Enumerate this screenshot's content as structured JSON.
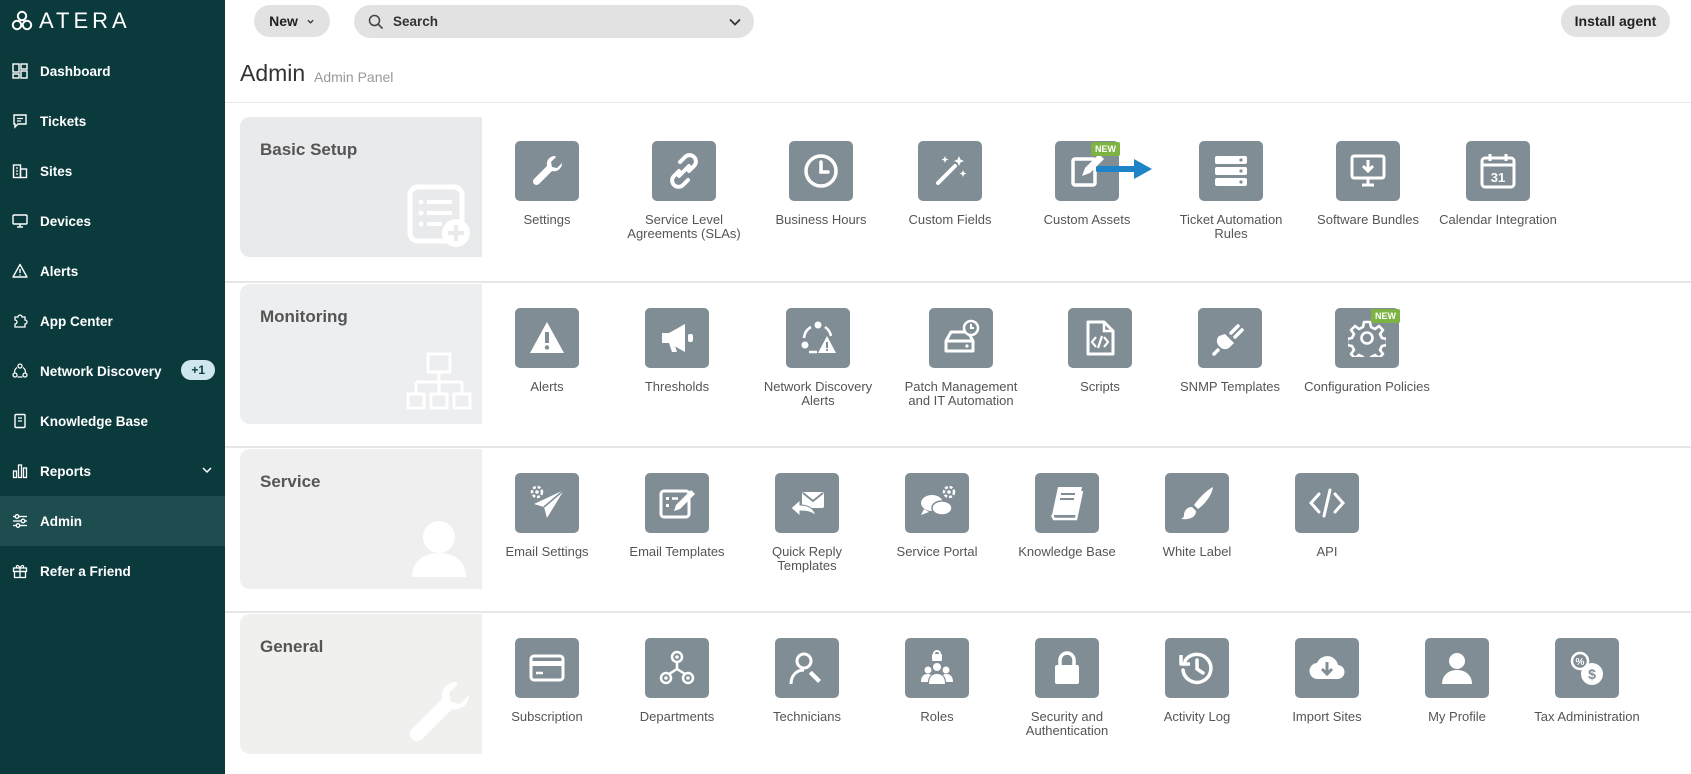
{
  "brand": {
    "name": "ATERA"
  },
  "sidebar": {
    "items": [
      {
        "label": "Dashboard",
        "icon": "dashboard-icon"
      },
      {
        "label": "Tickets",
        "icon": "tickets-icon"
      },
      {
        "label": "Sites",
        "icon": "sites-icon"
      },
      {
        "label": "Devices",
        "icon": "devices-icon"
      },
      {
        "label": "Alerts",
        "icon": "alerts-icon"
      },
      {
        "label": "App Center",
        "icon": "app-center-icon"
      },
      {
        "label": "Network Discovery",
        "icon": "network-discovery-icon",
        "badge": "+1"
      },
      {
        "label": "Knowledge Base",
        "icon": "knowledge-base-icon"
      },
      {
        "label": "Reports",
        "icon": "reports-icon"
      },
      {
        "label": "Admin",
        "icon": "admin-icon",
        "active": true
      },
      {
        "label": "Refer a Friend",
        "icon": "gift-icon"
      }
    ]
  },
  "topbar": {
    "new_label": "New",
    "search_placeholder": "Search",
    "install_label": "Install agent"
  },
  "header": {
    "title": "Admin",
    "subtitle": "Admin Panel"
  },
  "sections": [
    {
      "name": "Basic Setup",
      "tiles": [
        {
          "label": "Settings",
          "icon": "wrench-icon"
        },
        {
          "label": "Service Level Agreements (SLAs)",
          "icon": "link-icon"
        },
        {
          "label": "Business Hours",
          "icon": "clock-icon"
        },
        {
          "label": "Custom Fields",
          "icon": "magic-wand-icon"
        },
        {
          "label": "Custom Assets",
          "icon": "edit-clipboard-icon",
          "badge": "NEW"
        },
        {
          "label": "Ticket Automation Rules",
          "icon": "server-stack-icon"
        },
        {
          "label": "Software Bundles",
          "icon": "download-monitor-icon"
        },
        {
          "label": "Calendar Integration",
          "icon": "calendar-icon",
          "calendar_day": "31"
        }
      ]
    },
    {
      "name": "Monitoring",
      "tiles": [
        {
          "label": "Alerts",
          "icon": "warning-icon"
        },
        {
          "label": "Thresholds",
          "icon": "megaphone-icon"
        },
        {
          "label": "Network Discovery Alerts",
          "icon": "network-alert-icon"
        },
        {
          "label": "Patch Management and IT Automation",
          "icon": "drive-clock-icon"
        },
        {
          "label": "Scripts",
          "icon": "code-file-icon"
        },
        {
          "label": "SNMP Templates",
          "icon": "plug-icon"
        },
        {
          "label": "Configuration Policies",
          "icon": "gear-icon",
          "badge": "NEW"
        }
      ]
    },
    {
      "name": "Service",
      "tiles": [
        {
          "label": "Email Settings",
          "icon": "paper-plane-gear-icon"
        },
        {
          "label": "Email Templates",
          "icon": "edit-template-icon"
        },
        {
          "label": "Quick Reply Templates",
          "icon": "reply-envelope-icon"
        },
        {
          "label": "Service Portal",
          "icon": "chat-gear-icon"
        },
        {
          "label": "Knowledge Base",
          "icon": "book-icon"
        },
        {
          "label": "White Label",
          "icon": "brush-icon"
        },
        {
          "label": "API",
          "icon": "code-brackets-icon"
        }
      ]
    },
    {
      "name": "General",
      "tiles": [
        {
          "label": "Subscription",
          "icon": "credit-card-icon"
        },
        {
          "label": "Departments",
          "icon": "org-chart-icon"
        },
        {
          "label": "Technicians",
          "icon": "technician-icon"
        },
        {
          "label": "Roles",
          "icon": "users-lock-icon"
        },
        {
          "label": "Security and Authentication",
          "icon": "lock-icon"
        },
        {
          "label": "Activity Log",
          "icon": "history-icon"
        },
        {
          "label": "Import Sites",
          "icon": "cloud-download-icon"
        },
        {
          "label": "My Profile",
          "icon": "user-icon"
        },
        {
          "label": "Tax Administration",
          "icon": "tax-icon"
        }
      ]
    }
  ],
  "colors": {
    "sidebar_bg": "#0b3a3d",
    "sidebar_active": "#1e4d50",
    "tile_bg": "#818d95",
    "new_badge": "#7cb342",
    "arrow": "#1f84c7",
    "section_basic": "#e9eaec",
    "section_monitoring": "#eceef0",
    "section_service": "#efefef",
    "section_general": "#f0f0ee"
  }
}
